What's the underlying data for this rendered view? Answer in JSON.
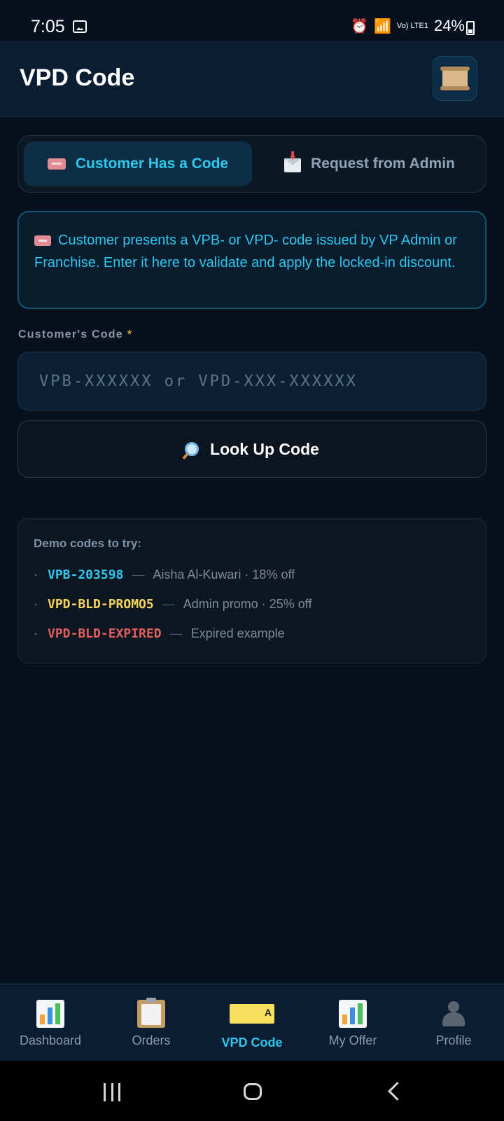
{
  "status_bar": {
    "time": "7:05",
    "network": "Vo) LTE1",
    "battery": "24%"
  },
  "header": {
    "title": "VPD Code",
    "scroll_icon": "scroll-icon"
  },
  "tabs": [
    {
      "label": "Customer Has a Code",
      "icon": "ticket-icon",
      "active": true
    },
    {
      "label": "Request from Admin",
      "icon": "envelope-icon",
      "active": false
    }
  ],
  "info": {
    "text": "Customer presents a VPB- or VPD- code issued by VP Admin or Franchise. Enter it here to validate and apply the locked-in discount."
  },
  "form": {
    "label": "Customer's Code",
    "required_mark": "*",
    "placeholder": "VPB-XXXXXX or VPD-XXX-XXXXXX",
    "value": "",
    "button_label": "Look Up Code"
  },
  "demo": {
    "title": "Demo codes to try:",
    "items": [
      {
        "bullet": "·",
        "code": "VPB-203598",
        "sep": "—",
        "desc": "Aisha Al-Kuwari · 18% off",
        "color": "#2ec7ee"
      },
      {
        "bullet": "·",
        "code": "VPD-BLD-PROMO5",
        "sep": "—",
        "desc": "Admin promo · 25% off",
        "color": "#f5d35a"
      },
      {
        "bullet": "·",
        "code": "VPD-BLD-EXPIRED",
        "sep": "—",
        "desc": "Expired example",
        "color": "#e05d5d"
      }
    ]
  },
  "nav": [
    {
      "label": "Dashboard",
      "icon": "bar-chart-icon"
    },
    {
      "label": "Orders",
      "icon": "clipboard-icon"
    },
    {
      "label": "VPD Code",
      "icon": "ticket-icon",
      "active": true
    },
    {
      "label": "My Offer",
      "icon": "bar-chart-icon"
    },
    {
      "label": "Profile",
      "icon": "person-icon"
    }
  ],
  "colors": {
    "accent": "#2ec7ee",
    "background": "#07111e",
    "header": "#0b1d33"
  }
}
